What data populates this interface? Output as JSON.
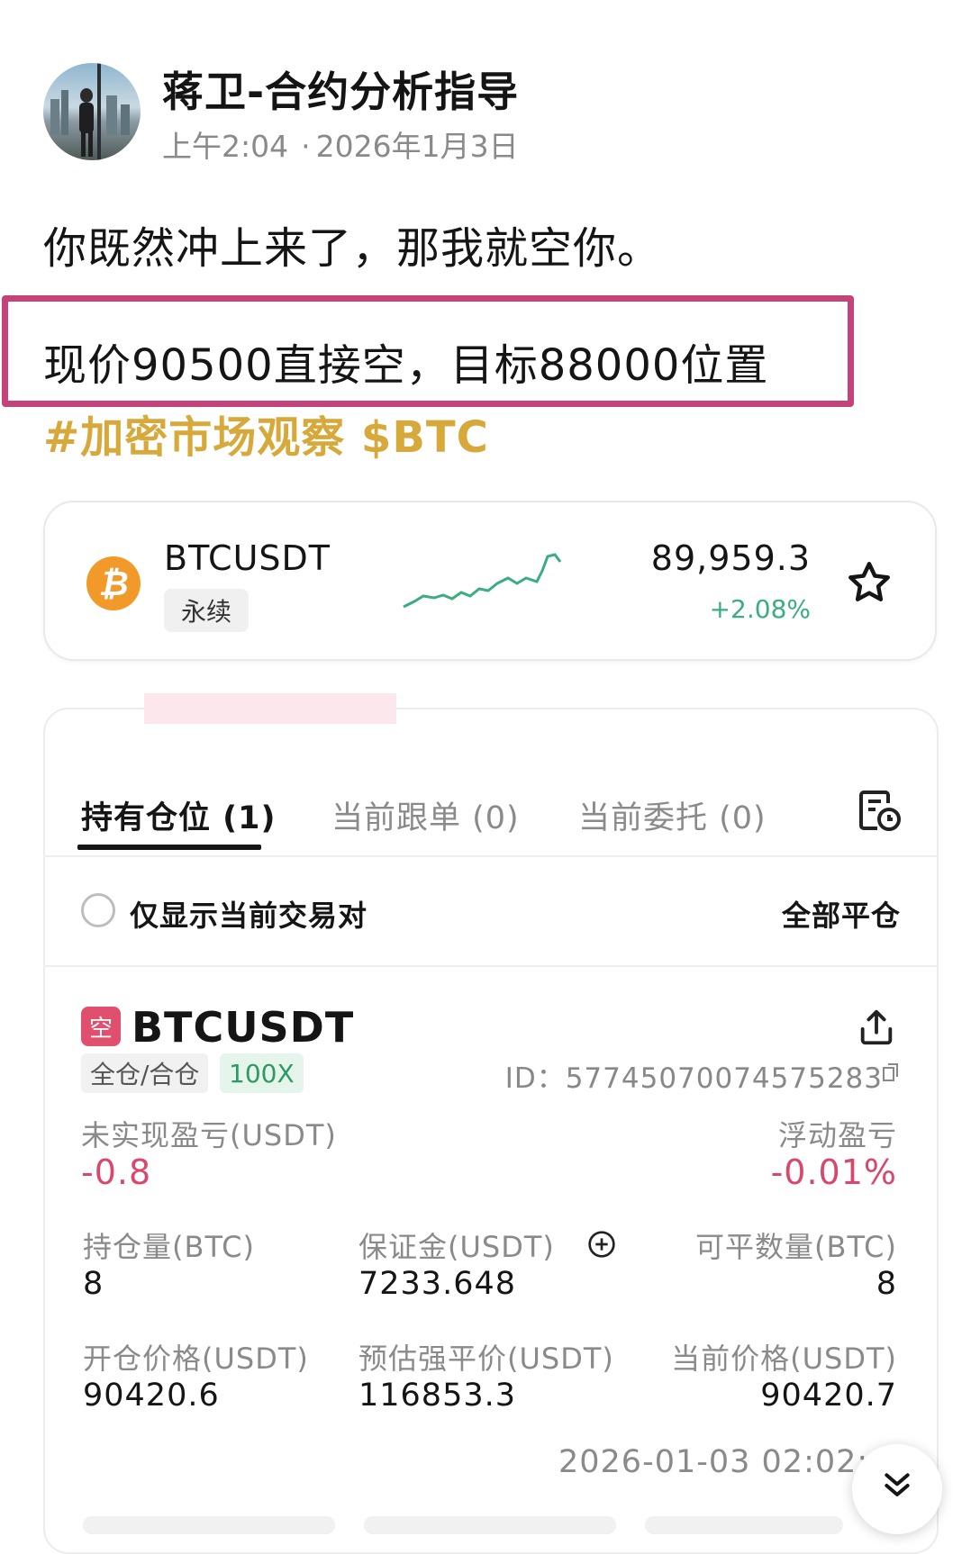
{
  "post": {
    "author": "蒋卫-合约分析指导",
    "time": "上午2:04",
    "date": "2026年1月3日",
    "line1": "你既然冲上来了，那我就空你。",
    "line2": "现价90500直接空，目标88000位置",
    "hashtags": "#加密市场观察 $BTC"
  },
  "ticker": {
    "symbol": "BTCUSDT",
    "badge": "永续",
    "price": "89,959.3",
    "change": "+2.08%",
    "colors": {
      "logo": "#f19a2a",
      "change": "#3aae7e",
      "sparkline": "#3aae7e"
    }
  },
  "tabs": [
    {
      "label": "持有仓位 (1)",
      "active": true
    },
    {
      "label": "当前跟单 (0)",
      "active": false
    },
    {
      "label": "当前委托 (0)",
      "active": false
    }
  ],
  "filter": {
    "label": "仅显示当前交易对",
    "close_all": "全部平仓"
  },
  "position": {
    "side_badge": "空",
    "symbol": "BTCUSDT",
    "margin_mode": "全仓/合仓",
    "leverage": "100X",
    "id": "ID：57745070074575283",
    "unrealized_label": "未实现盈亏(USDT)",
    "unrealized_value": "-0.8",
    "floating_label": "浮动盈亏",
    "floating_value": "-0.01%",
    "size_label": "持仓量(BTC)",
    "size_value": "8",
    "margin_label": "保证金(USDT)",
    "margin_value": "7233.648",
    "closable_label": "可平数量(BTC)",
    "closable_value": "8",
    "entry_label": "开仓价格(USDT)",
    "entry_value": "90420.6",
    "liq_label": "预估强平价(USDT)",
    "liq_value": "116853.3",
    "current_label": "当前价格(USDT)",
    "current_value": "90420.7",
    "timestamp": "2026-01-03 02:02:"
  },
  "colors": {
    "highlight_border": "#c4437a",
    "hashtag": "#d6a93a",
    "negative": "#d8486a"
  }
}
